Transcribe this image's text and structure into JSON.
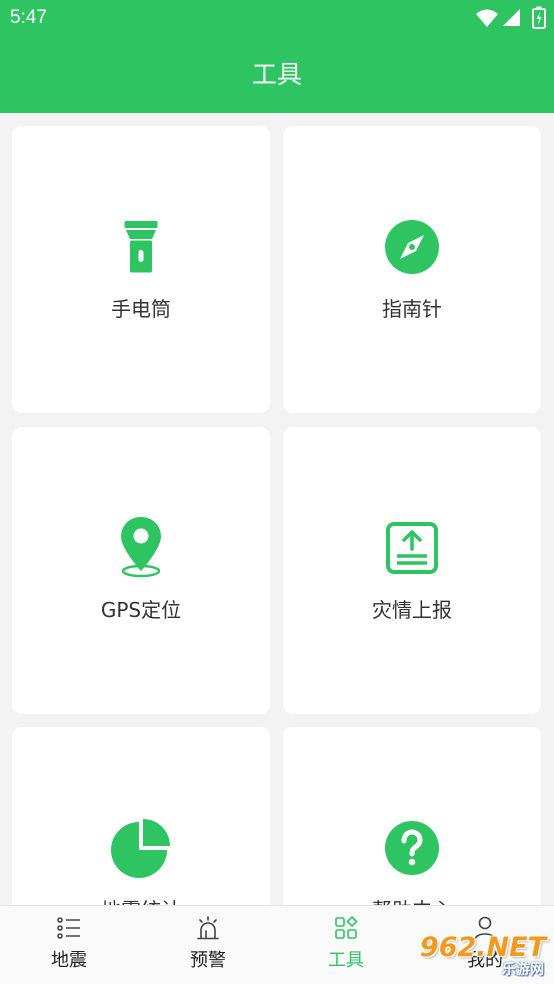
{
  "status_bar": {
    "time": "5:47",
    "icons": [
      "wifi-icon",
      "signal-icon",
      "battery-icon"
    ]
  },
  "header": {
    "title": "工具"
  },
  "tools": [
    {
      "label": "手电筒",
      "icon": "flashlight-icon"
    },
    {
      "label": "指南针",
      "icon": "compass-icon"
    },
    {
      "label": "GPS定位",
      "icon": "location-pin-icon"
    },
    {
      "label": "灾情上报",
      "icon": "report-upload-icon"
    },
    {
      "label": "地震统计",
      "icon": "pie-chart-icon"
    },
    {
      "label": "帮助中心",
      "icon": "help-icon"
    }
  ],
  "bottom_nav": {
    "items": [
      {
        "label": "地震",
        "icon": "list-icon",
        "active": false
      },
      {
        "label": "预警",
        "icon": "alarm-icon",
        "active": false
      },
      {
        "label": "工具",
        "icon": "grid-icon",
        "active": true
      },
      {
        "label": "我的",
        "icon": "person-icon",
        "active": false
      }
    ]
  },
  "watermark": {
    "line1": "962.NET",
    "line2": "乐游网"
  },
  "colors": {
    "primary": "#2ec462",
    "background": "#f3f3f3",
    "card": "#ffffff",
    "text": "#333333",
    "nav_background": "#fbfafa"
  }
}
